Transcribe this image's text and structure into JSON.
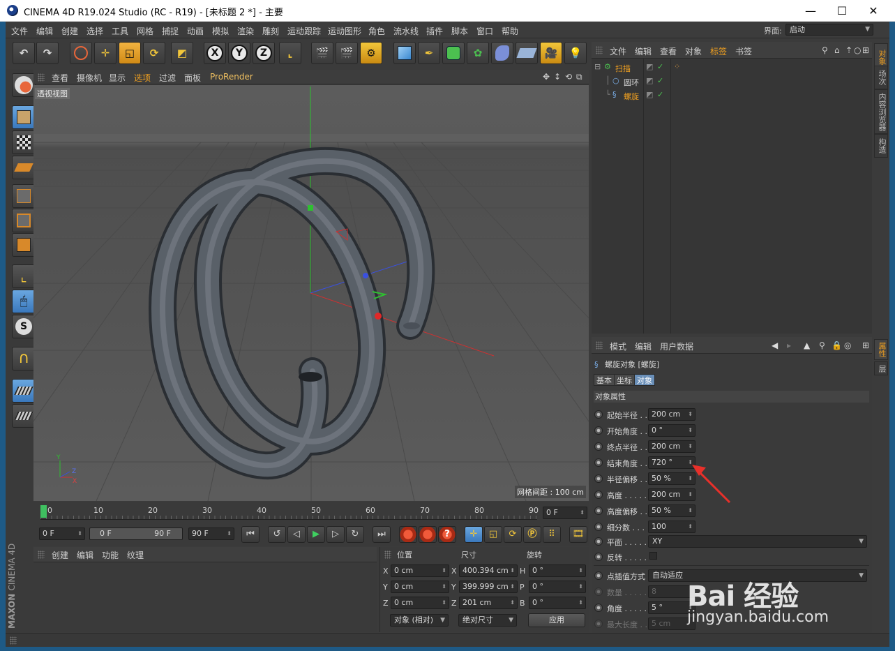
{
  "window": {
    "title": "CINEMA 4D R19.024 Studio (RC - R19) - [未标题 2 *] - 主要",
    "minimize": "—",
    "maximize": "☐",
    "close": "✕"
  },
  "menubar": {
    "items": [
      "文件",
      "编辑",
      "创建",
      "选择",
      "工具",
      "网格",
      "捕捉",
      "动画",
      "模拟",
      "渲染",
      "雕刻",
      "运动跟踪",
      "运动图形",
      "角色",
      "流水线",
      "插件",
      "脚本",
      "窗口",
      "帮助"
    ],
    "layout_label": "界面:",
    "layout_value": "启动"
  },
  "toolbar": {
    "axis_x": "X",
    "axis_y": "Y",
    "axis_z": "Z"
  },
  "viewport": {
    "menu": [
      "查看",
      "摄像机",
      "显示",
      "选项",
      "过滤",
      "面板",
      "ProRender"
    ],
    "label": "透视视图",
    "grid_spacing": "网格间距 : 100 cm",
    "axis_x": "X",
    "axis_y": "Y",
    "axis_z": "Z"
  },
  "timeline": {
    "ticks": [
      "0",
      "10",
      "20",
      "30",
      "40",
      "50",
      "60",
      "70",
      "80",
      "90"
    ],
    "current_frame": "0 F",
    "start_frame": "0 F",
    "range_start": "0 F",
    "range_end": "90 F",
    "end_frame": "90 F"
  },
  "materials": {
    "menu": [
      "创建",
      "编辑",
      "功能",
      "纹理"
    ]
  },
  "coordinates": {
    "headers": {
      "position": "位置",
      "size": "尺寸",
      "rotation": "旋转"
    },
    "rows": [
      {
        "axis": "X",
        "pos": "0 cm",
        "size_axis": "X",
        "size": "400.394 cm",
        "rot_axis": "H",
        "rot": "0 °"
      },
      {
        "axis": "Y",
        "pos": "0 cm",
        "size_axis": "Y",
        "size": "399.999 cm",
        "rot_axis": "P",
        "rot": "0 °"
      },
      {
        "axis": "Z",
        "pos": "0 cm",
        "size_axis": "Z",
        "size": "201 cm",
        "rot_axis": "B",
        "rot": "0 °"
      }
    ],
    "mode": "对象 (相对)",
    "size_mode": "绝对尺寸",
    "apply": "应用"
  },
  "object_manager": {
    "menu": [
      "文件",
      "编辑",
      "查看",
      "对象",
      "标签",
      "书签"
    ],
    "objects": [
      {
        "name": "扫描",
        "color": "#f0a020"
      },
      {
        "name": "圆环",
        "color": "#d8d8d8"
      },
      {
        "name": "螺旋",
        "color": "#f0a020"
      }
    ]
  },
  "attribute_manager": {
    "menu": [
      "模式",
      "编辑",
      "用户数据"
    ],
    "object_title": "螺旋对象 [螺旋]",
    "tabs": [
      "基本",
      "坐标",
      "对象"
    ],
    "section": "对象属性",
    "properties": [
      {
        "label": "起始半径 . .",
        "value": "200 cm",
        "dim": false
      },
      {
        "label": "开始角度 . .",
        "value": "0 °",
        "dim": false
      },
      {
        "label": "终点半径 . .",
        "value": "200 cm",
        "dim": false
      },
      {
        "label": "结束角度 . .",
        "value": "720 °",
        "dim": false
      },
      {
        "label": "半径偏移 . .",
        "value": "50 %",
        "dim": false
      },
      {
        "label": "高度 . . . . .",
        "value": "200 cm",
        "dim": false
      },
      {
        "label": "高度偏移 . .",
        "value": "50 %",
        "dim": false
      },
      {
        "label": "细分数 . . .",
        "value": "100",
        "dim": false
      }
    ],
    "plane_label": "平面 . . . . .",
    "plane_value": "XY",
    "reverse_label": "反转 . . . . .",
    "interp_label": "点插值方式",
    "interp_value": "自动适应",
    "count_label": "数量 . . . . .",
    "count_value": "8",
    "angle_label": "角度 . . . . .",
    "angle_value": "5 °",
    "maxlen_label": "最大长度 . .",
    "maxlen_value": "5 cm"
  },
  "right_tabs": [
    "对象",
    "场次",
    "内容浏览器",
    "构造"
  ],
  "right_tabs_lower": [
    "属性",
    "层"
  ],
  "branding": {
    "maxon": "MAXON",
    "cinema": "CINEMA 4D"
  },
  "watermark": {
    "logo": "Bai 经验",
    "url": "jingyan.baidu.com"
  }
}
